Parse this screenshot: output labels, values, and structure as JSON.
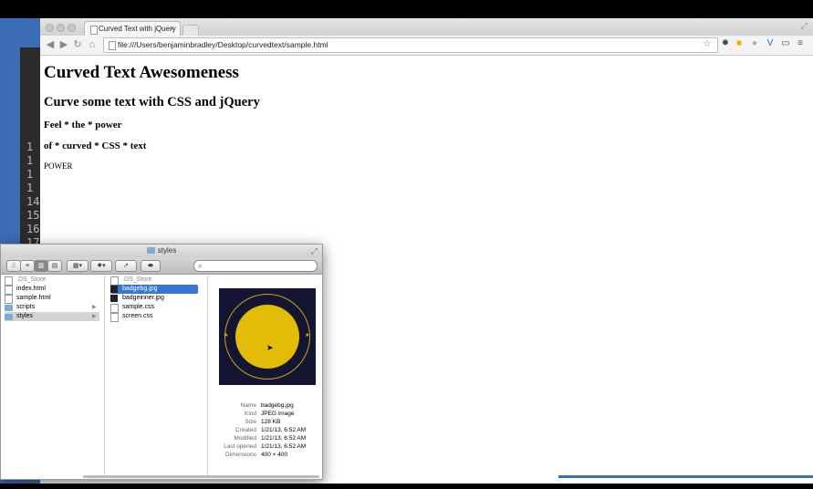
{
  "browser": {
    "tab_title": "Curved Text with jQuery",
    "tab_close": "×",
    "url": "file:///Users/benjaminbradley/Desktop/curvedtext/sample.html"
  },
  "page": {
    "h1": "Curved Text Awesomeness",
    "h2": "Curve some text with CSS and jQuery",
    "h3a": "Feel * the * power",
    "h3b": "of * curved * CSS * text",
    "p": "POWER"
  },
  "terminal": {
    "line_numbers": [
      "1",
      "1",
      "1",
      "1",
      "14",
      "15",
      "16",
      "17"
    ]
  },
  "finder": {
    "title": "styles",
    "col1": [
      {
        "name": ".DS_Store",
        "type": "file",
        "dim": true
      },
      {
        "name": "index.html",
        "type": "file"
      },
      {
        "name": "sample.html",
        "type": "file"
      },
      {
        "name": "scripts",
        "type": "folder"
      },
      {
        "name": "styles",
        "type": "folder",
        "selected": true
      }
    ],
    "col2": [
      {
        "name": ".DS_Store",
        "type": "file",
        "dim": true
      },
      {
        "name": "badgebg.jpg",
        "type": "image",
        "selected": true
      },
      {
        "name": "badgeinner.jpg",
        "type": "image"
      },
      {
        "name": "sample.css",
        "type": "file"
      },
      {
        "name": "screen.css",
        "type": "file"
      }
    ],
    "info": [
      {
        "k": "Name",
        "v": "badgebg.jpg"
      },
      {
        "k": "Kind",
        "v": "JPEG image"
      },
      {
        "k": "Size",
        "v": "128 KB"
      },
      {
        "k": "Created",
        "v": "1/21/13, 6:52 AM"
      },
      {
        "k": "Modified",
        "v": "1/21/13, 6:52 AM"
      },
      {
        "k": "Last opened",
        "v": "1/21/13, 6:52 AM"
      },
      {
        "k": "Dimensions",
        "v": "400 × 400"
      }
    ]
  },
  "colors": {
    "desktop": "#3c6cb4",
    "selection": "#3875d7",
    "badge_bg": "#141532",
    "badge_gold": "#e2bc07"
  }
}
